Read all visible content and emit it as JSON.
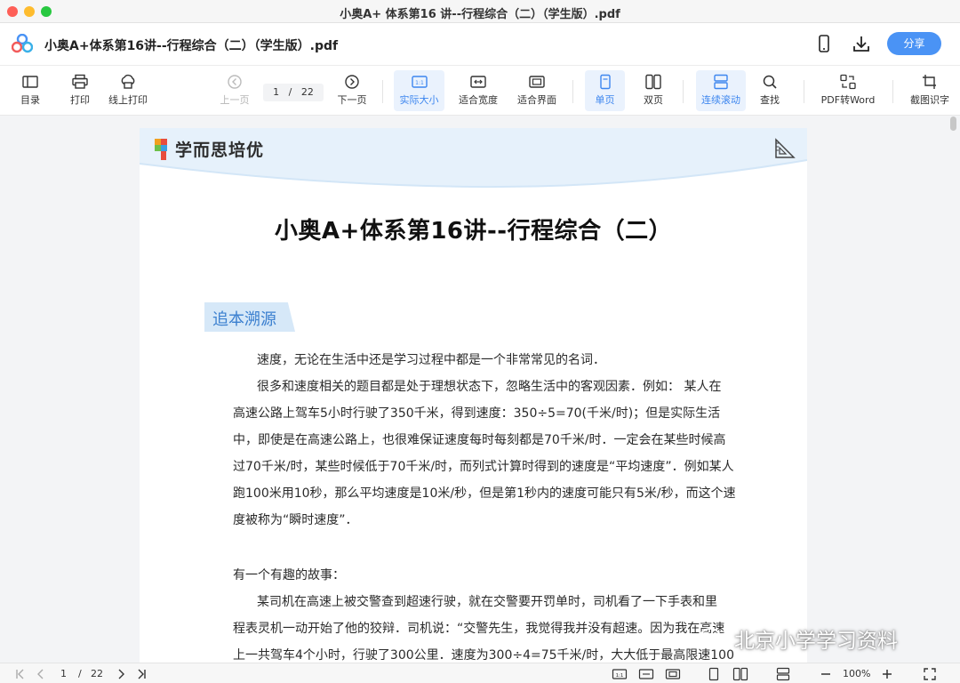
{
  "window": {
    "title": "小奥A+ 体系第16 讲--行程综合（二）（学生版）.pdf"
  },
  "header": {
    "doc_title": "小奥A+体系第16讲--行程综合（二）（学生版）.pdf",
    "share_label": "分享"
  },
  "toolbar": {
    "toc": "目录",
    "print": "打印",
    "online_print": "线上打印",
    "prev_page": "上一页",
    "page_current": "1",
    "page_sep": "/",
    "page_total": "22",
    "next_page": "下一页",
    "actual_size": "实际大小",
    "fit_width": "适合宽度",
    "fit_page": "适合界面",
    "single_page": "单页",
    "double_page": "双页",
    "continuous": "连续滚动",
    "find": "查找",
    "pdf_to_word": "PDF转Word",
    "ocr": "截图识字"
  },
  "document": {
    "brand": "学而思培优",
    "title": "小奥A+体系第16讲--行程综合（二）",
    "section": "追本溯源",
    "lines": [
      "速度，无论在生活中还是学习过程中都是一个非常常见的名词．",
      "很多和速度相关的题目都是处于理想状态下，忽略生活中的客观因素．例如： 某人在",
      "高速公路上驾车5小时行驶了350千米，得到速度：350÷5=70(千米/时)；但是实际生活",
      "中，即使是在高速公路上，也很难保证速度每时每刻都是70千米/时．一定会在某些时候高",
      "过70千米/时，某些时候低于70千米/时，而列式计算时得到的速度是“平均速度”．例如某人",
      "跑100米用10秒，那么平均速度是10米/秒，但是第1秒内的速度可能只有5米/秒，而这个速",
      "度被称为“瞬时速度”．",
      "有一个有趣的故事：",
      "某司机在高速上被交警查到超速行驶，就在交警要开罚单时，司机看了一下手表和里",
      "程表灵机一动开始了他的狡辩．司机说：“交警先生，我觉得我并没有超速。因为我在高速",
      "上一共驾车4个小时，行驶了300公里．速度为300÷4=75千米/时，大大低于最高限速100"
    ]
  },
  "watermark": {
    "text": "北京小学学习资料"
  },
  "bottombar": {
    "page_current": "1",
    "page_sep": "/",
    "page_total": "22",
    "zoom": "100%"
  },
  "colors": {
    "accent": "#4a93f5",
    "active_bg": "#eaf2fd",
    "section_text": "#3a7fcf",
    "section_bg": "#d6e8f8"
  }
}
